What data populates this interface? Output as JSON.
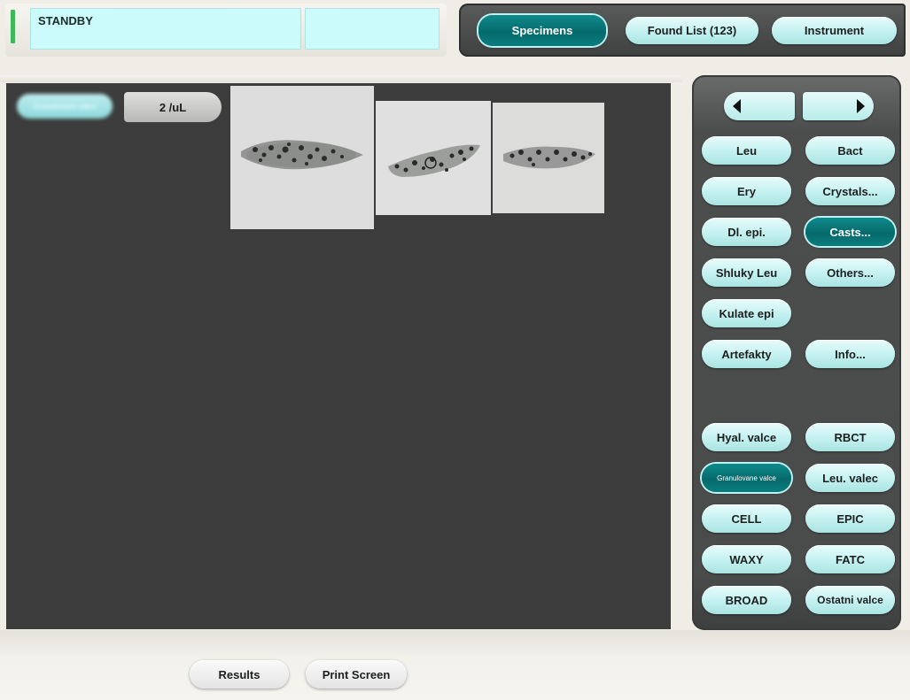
{
  "status": {
    "text": "STANDBY"
  },
  "top_nav": {
    "specimens_label": "Specimens",
    "found_list_label": "Found List (123)",
    "instrument_label": "Instrument"
  },
  "viewer": {
    "category_label": "Granulovane valce",
    "concentration": "2 /uL"
  },
  "right_panel": {
    "buttons": [
      "Leu",
      "Bact",
      "Ery",
      "Crystals...",
      "Dl. epi.",
      "Casts...",
      "Shluky Leu",
      "Others...",
      "Kulate epi",
      "Artefakty",
      "Info...",
      "Hyal. valce",
      "RBCT",
      "Granulovane valce",
      "Leu. valec",
      "CELL",
      "EPIC",
      "WAXY",
      "FATC",
      "BROAD",
      "Ostatni valce"
    ],
    "active": [
      "Casts...",
      "Granulovane valce"
    ]
  },
  "bottom": {
    "results_label": "Results",
    "print_label": "Print Screen"
  },
  "colors": {
    "accent_teal": "#066a6c",
    "pill_light": "#c6f2f2",
    "status_bg": "#ccfbfb",
    "viewer_bg": "#3b3c3b"
  }
}
